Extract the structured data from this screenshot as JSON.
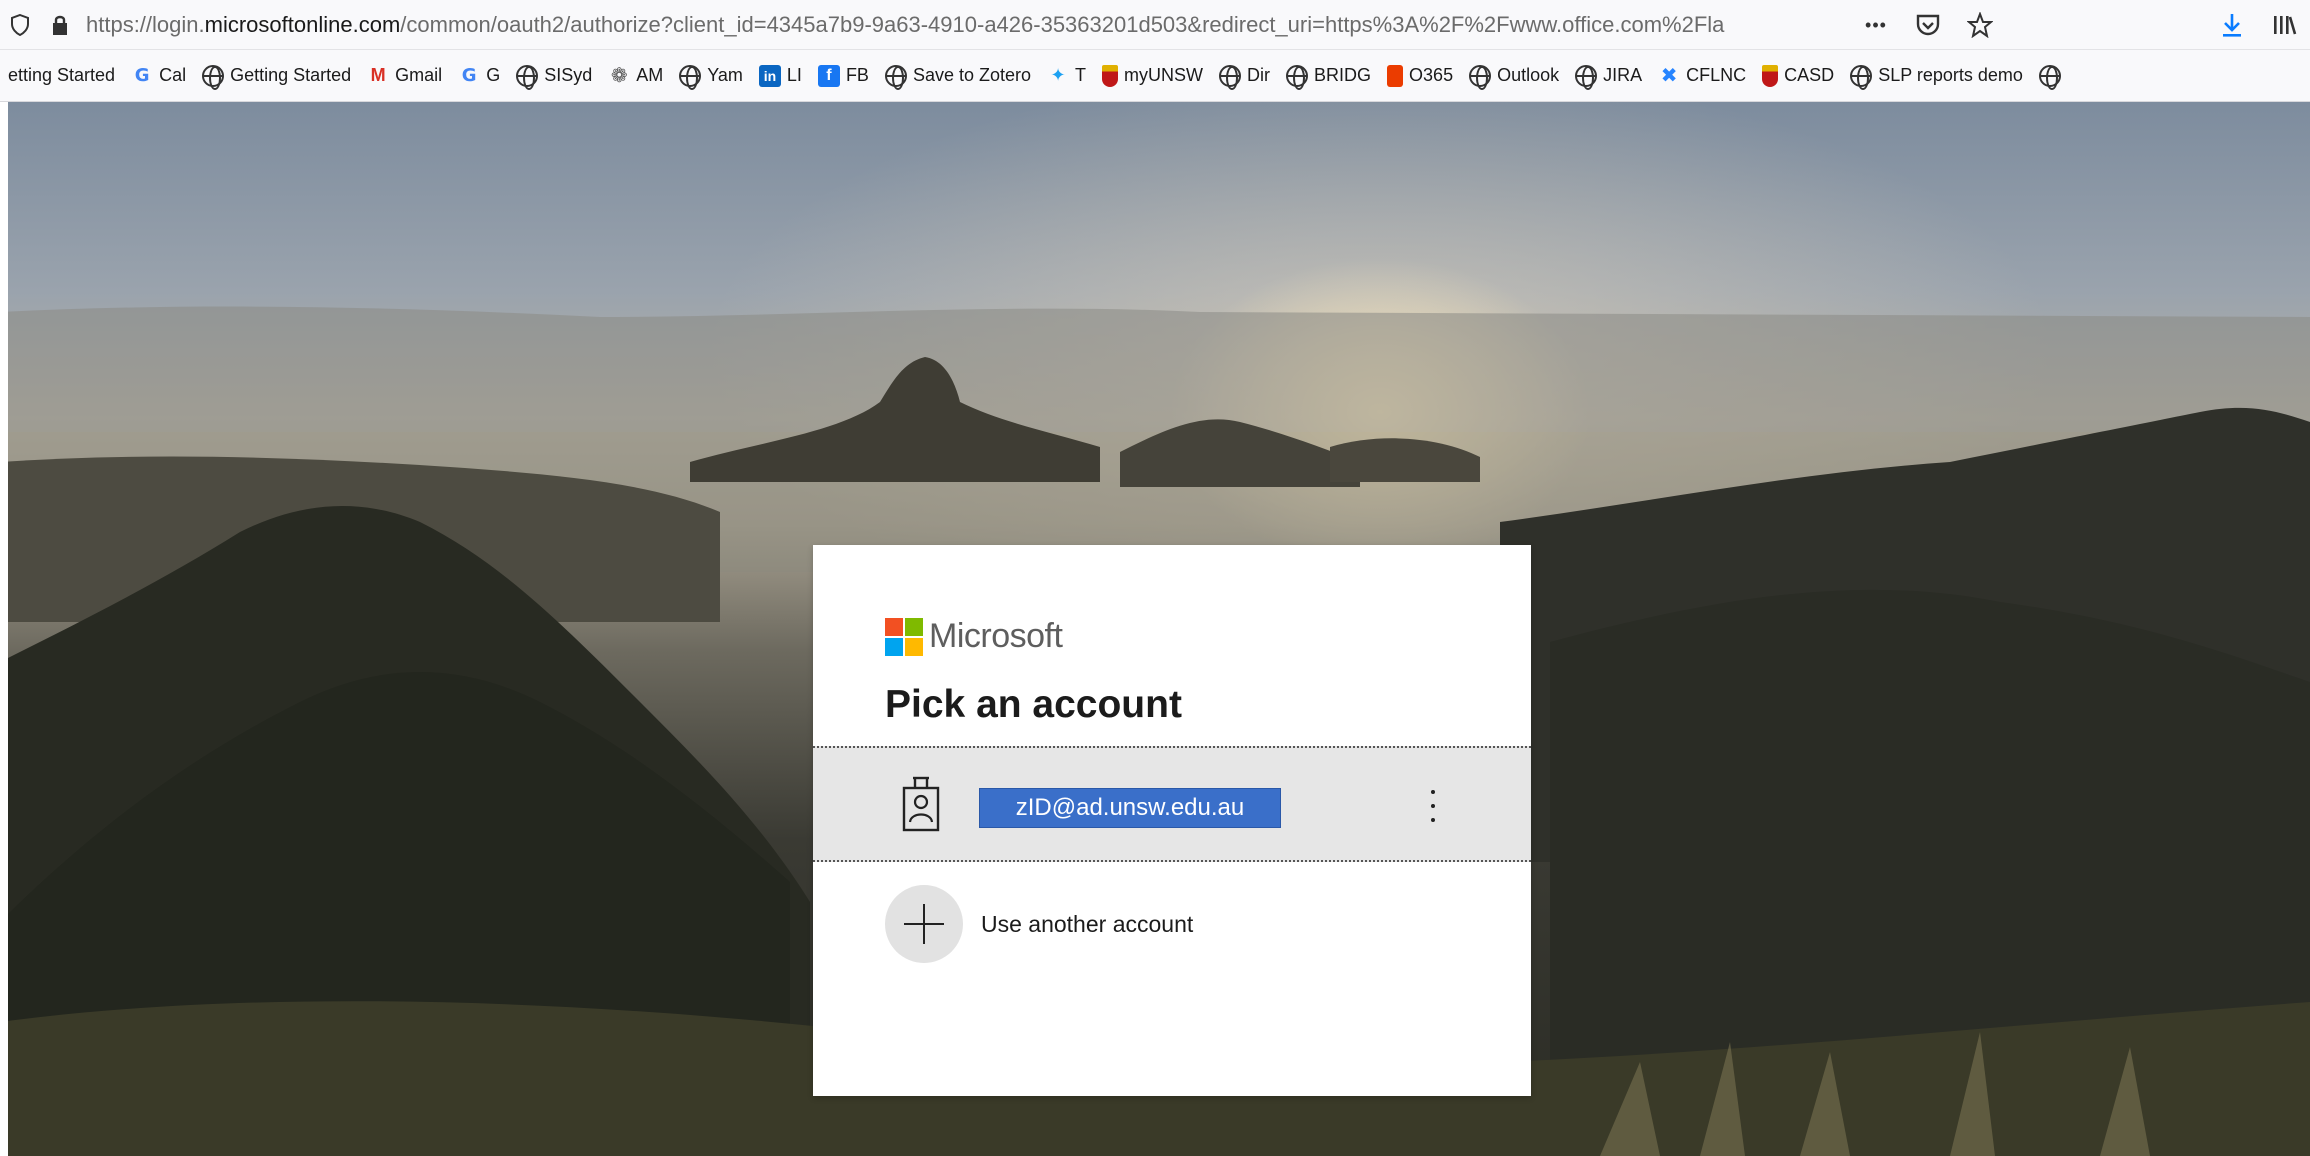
{
  "browser": {
    "url_prefix": "https://login.",
    "url_host": "microsoftonline.com",
    "url_rest": "/common/oauth2/authorize?client_id=4345a7b9-9a63-4910-a426-35363201d503&redirect_uri=https%3A%2F%2Fwww.office.com%2Fla",
    "icons": [
      "shield-icon",
      "lock-icon",
      "more-icon",
      "pocket-icon",
      "star-icon",
      "download-icon",
      "library-icon"
    ],
    "more_label": "•••"
  },
  "bookmarks": [
    {
      "label": "etting Started",
      "icon": "none"
    },
    {
      "label": "Cal",
      "icon": "g"
    },
    {
      "label": "Getting Started",
      "icon": "globe"
    },
    {
      "label": "Gmail",
      "icon": "gm"
    },
    {
      "label": "G",
      "icon": "g"
    },
    {
      "label": "SISyd",
      "icon": "globe"
    },
    {
      "label": "AM",
      "icon": "am"
    },
    {
      "label": "Yam",
      "icon": "globe"
    },
    {
      "label": "LI",
      "icon": "li"
    },
    {
      "label": "FB",
      "icon": "fb"
    },
    {
      "label": "Save to Zotero",
      "icon": "globe"
    },
    {
      "label": "T",
      "icon": "tw"
    },
    {
      "label": "myUNSW",
      "icon": "crest"
    },
    {
      "label": "Dir",
      "icon": "globe"
    },
    {
      "label": "BRIDG",
      "icon": "globe"
    },
    {
      "label": "O365",
      "icon": "o365"
    },
    {
      "label": "Outlook",
      "icon": "globe"
    },
    {
      "label": "JIRA",
      "icon": "globe"
    },
    {
      "label": "CFLNC",
      "icon": "conf"
    },
    {
      "label": "CASD",
      "icon": "crest"
    },
    {
      "label": "SLP reports demo",
      "icon": "globe"
    },
    {
      "label": "",
      "icon": "globe"
    }
  ],
  "dialog": {
    "brand": "Microsoft",
    "brand_colors": [
      "#f25022",
      "#7fba00",
      "#00a4ef",
      "#ffb900"
    ],
    "title": "Pick an account",
    "account_email": "zID@ad.unsw.edu.au",
    "another_account_label": "Use another account"
  }
}
